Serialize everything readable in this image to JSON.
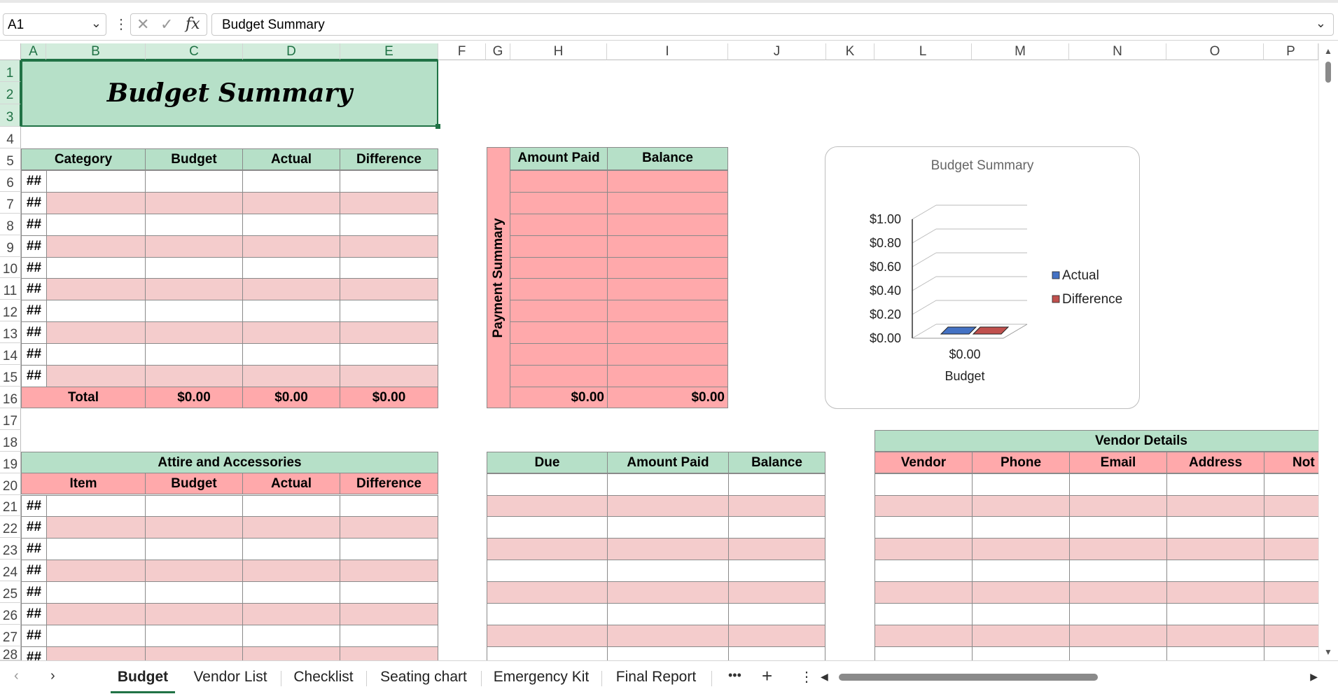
{
  "formula_bar": {
    "name_box": "A1",
    "cancel_icon": "✕",
    "enter_icon": "✓",
    "fx_icon": "fx",
    "formula": "Budget Summary"
  },
  "columns": [
    "A",
    "B",
    "C",
    "D",
    "E",
    "F",
    "G",
    "H",
    "I",
    "J",
    "K",
    "L",
    "M",
    "N",
    "O",
    "P"
  ],
  "rows": [
    "1",
    "2",
    "3",
    "4",
    "5",
    "6",
    "7",
    "8",
    "9",
    "10",
    "11",
    "12",
    "13",
    "14",
    "15",
    "16",
    "17",
    "18",
    "19",
    "20",
    "21",
    "22",
    "23",
    "24",
    "25",
    "26",
    "27",
    "28"
  ],
  "title": "Budget Summary",
  "budget_table": {
    "headers": [
      "Category",
      "Budget",
      "Actual",
      "Difference"
    ],
    "row_marker": "##",
    "total_label": "Total",
    "totals": [
      "$0.00",
      "$0.00",
      "$0.00"
    ]
  },
  "payment_summary": {
    "side_label": "Payment Summary",
    "headers": [
      "Amount Paid",
      "Balance"
    ],
    "totals": [
      "$0.00",
      "$0.00"
    ]
  },
  "chart_data": {
    "type": "bar",
    "title": "Budget Summary",
    "categories": [
      "Budget"
    ],
    "category_value_label": "$0.00",
    "series": [
      {
        "name": "Actual",
        "values": [
          0
        ],
        "color": "#4472c4"
      },
      {
        "name": "Difference",
        "values": [
          0
        ],
        "color": "#c0504d"
      }
    ],
    "yticks": [
      "$1.00",
      "$0.80",
      "$0.60",
      "$0.40",
      "$0.20",
      "$0.00"
    ],
    "ylim": [
      0,
      1
    ],
    "legend": "right",
    "grid": true
  },
  "attire_table": {
    "title": "Attire and Accessories",
    "headers": [
      "Item",
      "Budget",
      "Actual",
      "Difference"
    ],
    "row_marker": "##"
  },
  "due_table": {
    "headers": [
      "Due",
      "Amount Paid",
      "Balance"
    ]
  },
  "vendor_table": {
    "title": "Vendor Details",
    "headers": [
      "Vendor",
      "Phone",
      "Email",
      "Address",
      "Not"
    ]
  },
  "sheet_tabs": {
    "tabs": [
      "Budget",
      "Vendor List",
      "Checklist",
      "Seating chart",
      "Emergency Kit",
      "Final Report"
    ],
    "active": "Budget",
    "more": "•••",
    "add": "+",
    "options": "⋮"
  },
  "colors": {
    "green": "#b6e0c8",
    "pink": "#ffa9ab",
    "light_pink": "#f4cccc",
    "accent": "#207245"
  }
}
